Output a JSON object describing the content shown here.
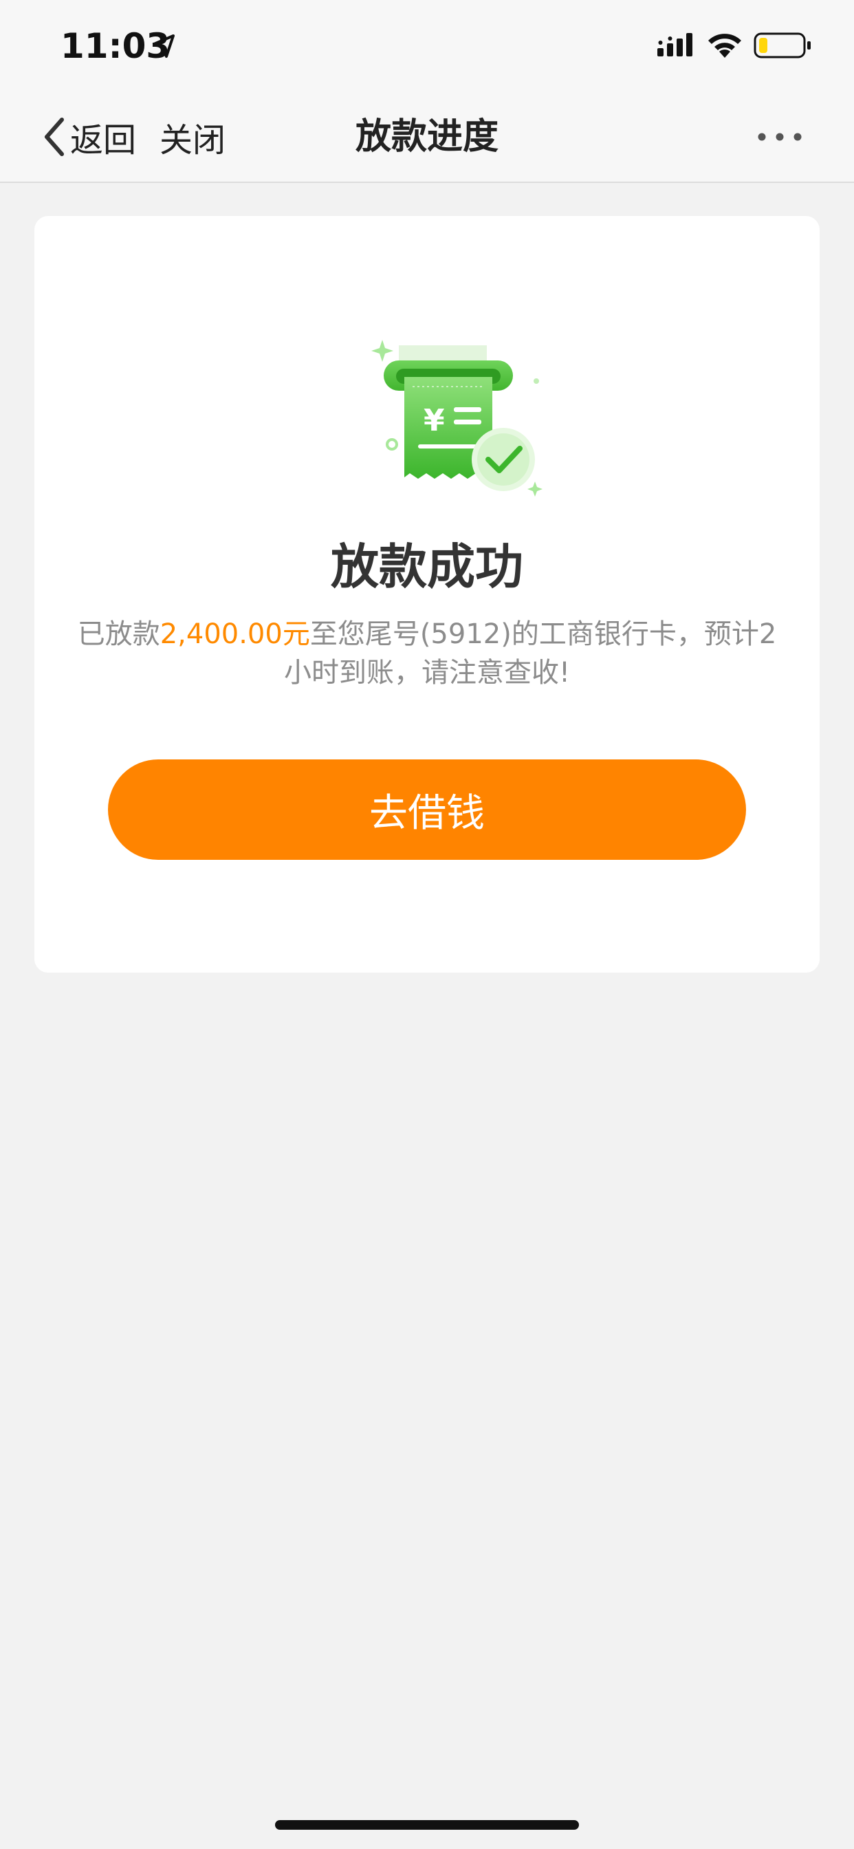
{
  "status_bar": {
    "time": "11:03",
    "icons": [
      "location-arrow-icon",
      "signal-icon",
      "wifi-icon",
      "battery-icon"
    ],
    "battery_color": "#ffd60a"
  },
  "nav": {
    "back_label": "返回",
    "close_label": "关闭",
    "title": "放款进度",
    "more_icon": "more-dots-icon"
  },
  "result": {
    "illustration_icon": "receipt-success-icon",
    "title": "放款成功",
    "desc_prefix": "已放款",
    "desc_amount": "2,400.00元",
    "desc_suffix": "至您尾号(5912)的工商银行卡，预计2小时到账，请注意查收!",
    "button_label": "去借钱"
  },
  "colors": {
    "accent": "#ff8400",
    "amount": "#ff8a00",
    "success_green": "#4cc23a"
  }
}
